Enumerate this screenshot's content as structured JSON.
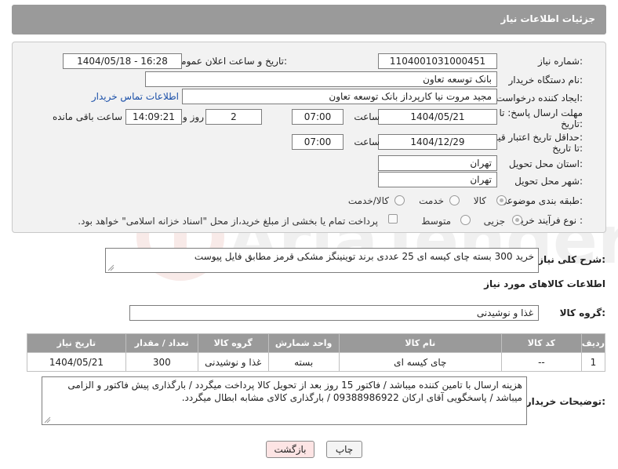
{
  "header": {
    "title": "جزئیات اطلاعات نیاز"
  },
  "form": {
    "need_number_label": "شماره نیاز:",
    "need_number": "1104001031000451",
    "announce_label": "تاریخ و ساعت اعلان عمومی:",
    "announce_value": "1404/05/18 - 16:28",
    "buyer_org_label": "نام دستگاه خریدار:",
    "buyer_org": "بانک توسعه تعاون",
    "creator_label": "ایجاد کننده درخواست:",
    "creator": "مجید مروت نیا کارپرداز بانک توسعه تعاون",
    "contact_link": "اطلاعات تماس خریدار",
    "reply_deadline_label_1": "مهلت ارسال پاسخ: تا",
    "reply_deadline_label_2": "تاریخ:",
    "reply_date": "1404/05/21",
    "hour_label": "ساعت",
    "reply_time": "07:00",
    "days_value": "2",
    "days_label": "روز و",
    "remaining_time": "14:09:21",
    "remaining_label": "ساعت باقی مانده",
    "price_deadline_label_1": "حداقل تاریخ اعتبار قیمت:",
    "price_deadline_label_2": "تا تاریخ:",
    "price_date": "1404/12/29",
    "price_hour_label": "ساعت",
    "price_time": "07:00",
    "province_label": "استان محل تحویل:",
    "province": "تهران",
    "city_label": "شهر محل تحویل:",
    "city": "تهران",
    "category_label": "طبقه بندی موضوعی:",
    "category_options": [
      "کالا",
      "خدمت",
      "کالا/خدمت"
    ],
    "category_selected": "کالا",
    "process_label": "نوع فرآیند خرید :",
    "process_options": [
      "جزیی",
      "متوسط"
    ],
    "process_selected": "جزیی",
    "payment_note": "پرداخت تمام یا بخشی از مبلغ خرید،از محل \"اسناد خزانه اسلامی\" خواهد بود."
  },
  "description": {
    "label": "شرح کلی نیاز:",
    "text": "خرید 300 بسته چای کیسه ای 25 عددی برند توینینگز مشکی قرمز مطابق فایل پیوست"
  },
  "goods": {
    "section_title": "اطلاعات کالاهای مورد نیاز",
    "group_label": "گروه کالا:",
    "group_value": "غذا و نوشیدنی",
    "columns": [
      "ردیف",
      "کد کالا",
      "نام کالا",
      "واحد شمارش",
      "گروه کالا",
      "تعداد / مقدار",
      "تاریخ نیاز"
    ],
    "rows": [
      [
        "1",
        "--",
        "چای کیسه ای",
        "بسته",
        "غذا و نوشیدنی",
        "300",
        "1404/05/21"
      ]
    ]
  },
  "buyer_notes": {
    "label": "توضیحات خریدار:",
    "text": "هزینه ارسال با تامین کننده میباشد / فاکتور 15 روز بعد از تحویل کالا پرداخت میگردد / بارگذاری پیش فاکتور و الزامی میباشد / پاسخگویی آقای ارکان 09388986922 / بارگذاری کالای مشابه ابطال میگردد."
  },
  "buttons": {
    "print": "چاپ",
    "back": "بازگشت"
  },
  "watermark_text": "AriaTender.net",
  "colors": {
    "header": "#9a9a9a",
    "back_button": "#fde4e4",
    "watermark": "#c0392b"
  }
}
